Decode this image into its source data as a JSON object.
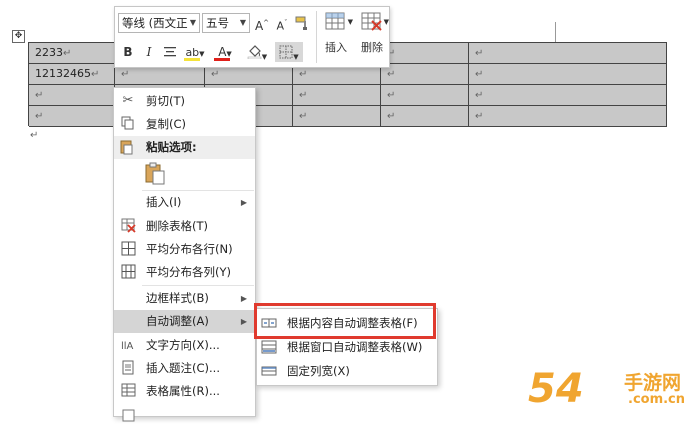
{
  "table": {
    "rows": [
      [
        "2233",
        "",
        "",
        "",
        ""
      ],
      [
        "12132465",
        "",
        "",
        "",
        ""
      ],
      [
        "",
        "",
        "",
        "",
        ""
      ],
      [
        "",
        "",
        "",
        "",
        ""
      ]
    ],
    "cell_mark": "↵"
  },
  "paragraph_mark": "↵",
  "toolbar": {
    "font_name": "等线 (西文正",
    "font_size": "五号",
    "grow_font": "A",
    "shrink_font": "A",
    "bold": "B",
    "italic": "I",
    "highlight_label": "ab",
    "font_color_label": "A",
    "insert_label": "插入",
    "delete_label": "删除"
  },
  "context_menu": {
    "items": [
      {
        "label": "剪切(T)",
        "icon": "scissors-icon"
      },
      {
        "label": "复制(C)",
        "icon": "copy-icon"
      },
      {
        "label": "粘贴选项:",
        "icon": "paste-icon"
      },
      {
        "label": "插入(I)",
        "icon": "",
        "submenu": true
      },
      {
        "label": "删除表格(T)",
        "icon": "delete-table-icon"
      },
      {
        "label": "平均分布各行(N)",
        "icon": "distribute-rows-icon"
      },
      {
        "label": "平均分布各列(Y)",
        "icon": "distribute-columns-icon"
      },
      {
        "label": "边框样式(B)",
        "icon": "",
        "submenu": true
      },
      {
        "label": "自动调整(A)",
        "icon": "",
        "submenu": true,
        "highlighted": true
      },
      {
        "label": "文字方向(X)...",
        "icon": "text-direction-icon"
      },
      {
        "label": "插入题注(C)...",
        "icon": "insert-caption-icon"
      },
      {
        "label": "表格属性(R)...",
        "icon": "table-properties-icon"
      }
    ]
  },
  "autofit_submenu": {
    "items": [
      {
        "label": "根据内容自动调整表格(F)",
        "icon": "autofit-contents-icon"
      },
      {
        "label": "根据窗口自动调整表格(W)",
        "icon": "autofit-window-icon"
      },
      {
        "label": "固定列宽(X)",
        "icon": "fixed-column-width-icon"
      }
    ]
  },
  "watermark": {
    "number": "54",
    "brand": "手游网",
    "url": ".com.cn"
  },
  "colors": {
    "table_fill": "#c8c8c8",
    "highlight_border": "#e03a2e",
    "font_color_bar": "#e0201a",
    "highlight_bar": "#f5e33a",
    "watermark_orange": "#f0a530"
  }
}
